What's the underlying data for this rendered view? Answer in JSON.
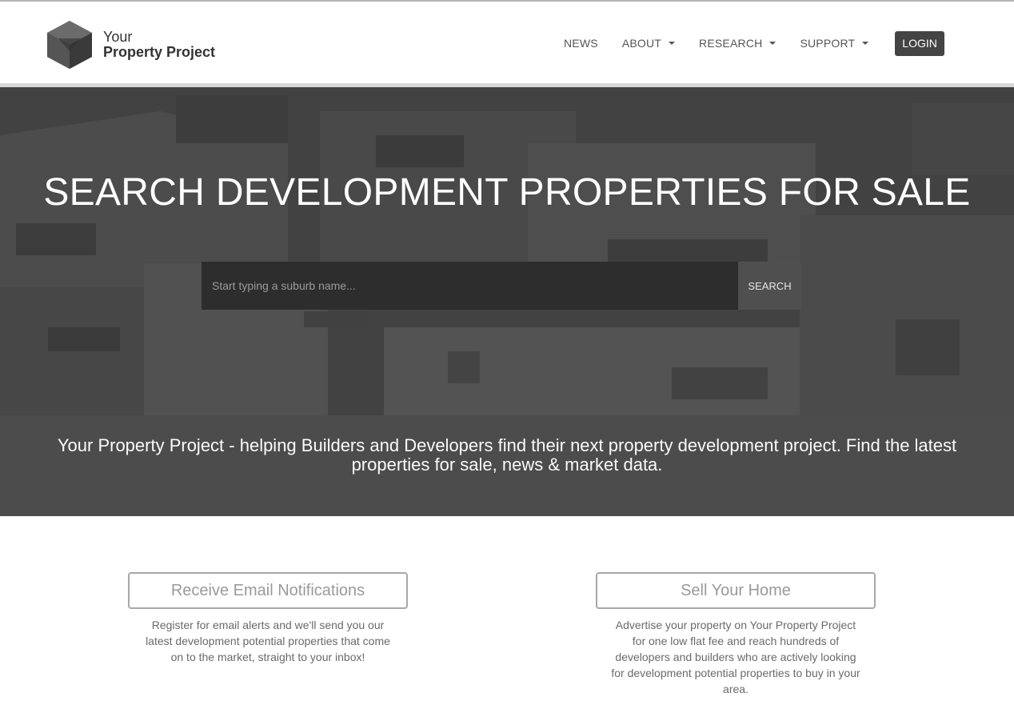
{
  "header": {
    "logo": {
      "line1": "Your",
      "line2": "Property Project",
      "icon": "cube-icon"
    },
    "nav": [
      {
        "label": "NEWS",
        "dropdown": false
      },
      {
        "label": "ABOUT",
        "dropdown": true
      },
      {
        "label": "RESEARCH",
        "dropdown": true
      },
      {
        "label": "SUPPORT",
        "dropdown": true
      }
    ],
    "login_label": "LOGIN"
  },
  "hero": {
    "title": "SEARCH DEVELOPMENT PROPERTIES FOR SALE",
    "search": {
      "placeholder": "Start typing a suburb name...",
      "value": "",
      "button_label": "SEARCH"
    }
  },
  "tagline": "Your Property Project - helping Builders and Developers find their next property development project. Find the latest properties for sale, news & market data.",
  "features": [
    {
      "button_label": "Receive Email Notifications",
      "description": "Register for email alerts and we'll send you our latest development potential properties that come on to the market, straight to your inbox!"
    },
    {
      "button_label": "Sell Your Home",
      "description": "Advertise your property on Your Property Project for one low flat fee and reach hundreds of developers and builders who are actively looking for development potential properties to buy in your area."
    }
  ],
  "colors": {
    "header_bg": "#ffffff",
    "login_bg": "#444444",
    "tagline_bg": "#4c4c4c",
    "hero_overlay": "#474747"
  }
}
